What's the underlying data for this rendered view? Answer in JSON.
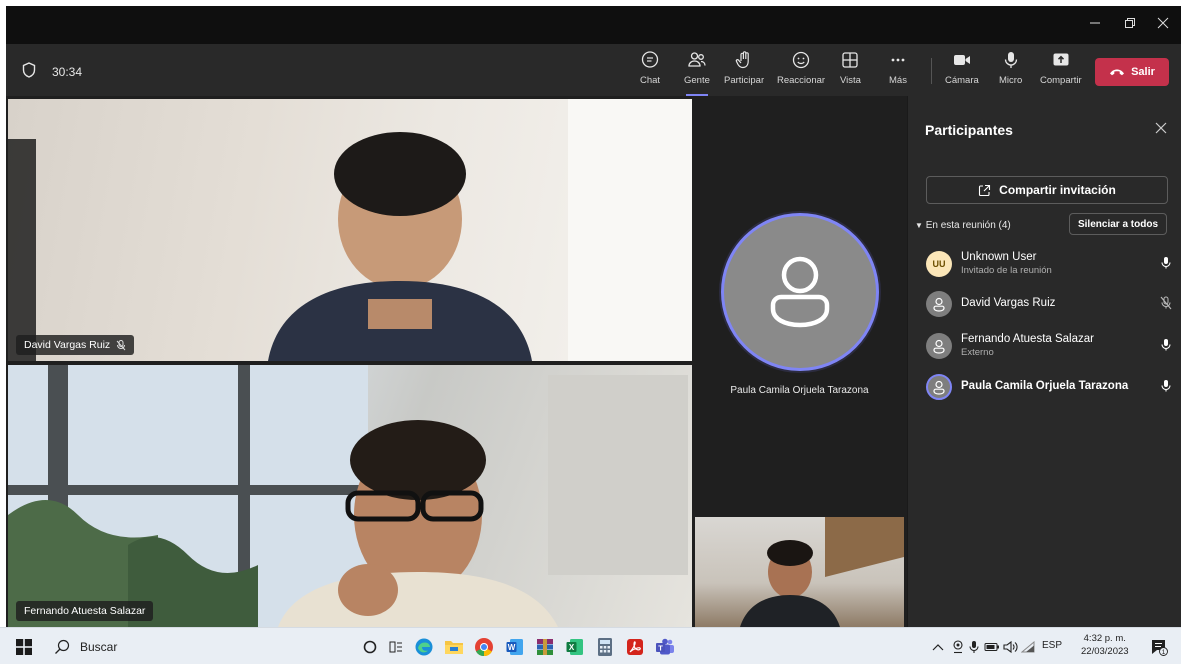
{
  "toolbar": {
    "timer": "30:34",
    "buttons": [
      {
        "label": "Chat",
        "icon": "chat-icon"
      },
      {
        "label": "Gente",
        "icon": "people-icon",
        "active": true
      },
      {
        "label": "Participar",
        "icon": "raise-hand-icon"
      },
      {
        "label": "Reaccionar",
        "icon": "smiley-icon"
      },
      {
        "label": "Vista",
        "icon": "grid-icon"
      },
      {
        "label": "Más",
        "icon": "more-icon"
      },
      {
        "label": "Cámara",
        "icon": "camera-icon"
      },
      {
        "label": "Micro",
        "icon": "mic-icon"
      },
      {
        "label": "Compartir",
        "icon": "share-screen-icon"
      }
    ],
    "leave_label": "Salir",
    "leave_color": "#c4314b",
    "accent": "#7f85f5"
  },
  "stage": {
    "video1_name": "David Vargas Ruiz",
    "video2_name": "Fernando Atuesta Salazar",
    "avatar_name": "Paula Camila Orjuela Tarazona"
  },
  "panel": {
    "title": "Participantes",
    "share_invite": "Compartir invitación",
    "section": "En esta reunión (4)",
    "mute_all": "Silenciar a todos",
    "participants": [
      {
        "name": "Unknown User",
        "sub": "Invitado de la reunión",
        "initials": "UU",
        "mic": "on"
      },
      {
        "name": "David Vargas Ruiz",
        "sub": "",
        "mic": "muted"
      },
      {
        "name": "Fernando Atuesta Salazar",
        "sub": "Externo",
        "mic": "on"
      },
      {
        "name": "Paula Camila Orjuela Tarazona",
        "sub": "",
        "mic": "on",
        "speaking": true
      }
    ]
  },
  "taskbar": {
    "search_label": "Buscar",
    "lang": "ESP",
    "time": "4:32 p. m.",
    "date": "22/03/2023",
    "notification_count": "1"
  }
}
